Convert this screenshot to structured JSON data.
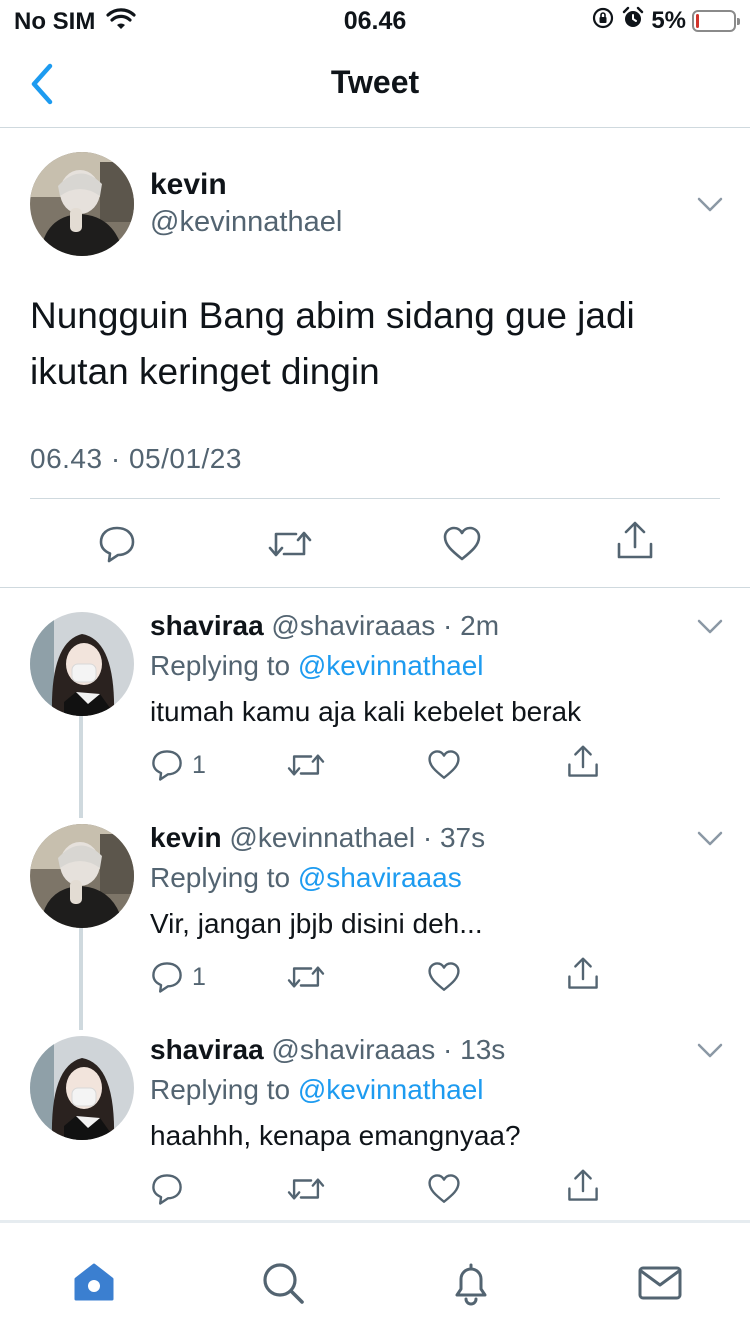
{
  "status_bar": {
    "carrier": "No SIM",
    "time": "06.46",
    "battery_percent": "5%",
    "battery_level": 0.05
  },
  "nav": {
    "title": "Tweet"
  },
  "main_tweet": {
    "name": "kevin",
    "handle": "@kevinnathael",
    "text": "Nungguin Bang abim sidang gue jadi ikutan keringet dingin",
    "meta": "06.43 · 05/01/23"
  },
  "replies": [
    {
      "name": "shaviraa",
      "handle": "@shaviraaas",
      "dot": "·",
      "time": "2m",
      "replying_prefix": "Replying to",
      "replying_to": "@kevinnathael",
      "text": "itumah kamu aja kali kebelet berak",
      "reply_count": "1"
    },
    {
      "name": "kevin",
      "handle": "@kevinnathael",
      "dot": "·",
      "time": "37s",
      "replying_prefix": "Replying to",
      "replying_to": "@shaviraaas",
      "text": "Vir, jangan jbjb disini deh...",
      "reply_count": "1"
    },
    {
      "name": "shaviraa",
      "handle": "@shaviraaas",
      "dot": "·",
      "time": "13s",
      "replying_prefix": "Replying to",
      "replying_to": "@kevinnathael",
      "text": "haahhh, kenapa emangnyaa?",
      "reply_count": ""
    }
  ],
  "icons": {
    "back": "chevron-left-icon",
    "more": "chevron-down-icon",
    "reply": "speech-bubble-icon",
    "retweet": "retweet-icon",
    "like": "heart-icon",
    "share": "share-icon",
    "home": "home-icon",
    "search": "search-icon",
    "notifications": "bell-icon",
    "messages": "envelope-icon"
  },
  "colors": {
    "accent": "#1d9bf0",
    "secondary_text": "#536471",
    "divider": "#cfd9de",
    "tab_active": "#3b7fd0"
  }
}
